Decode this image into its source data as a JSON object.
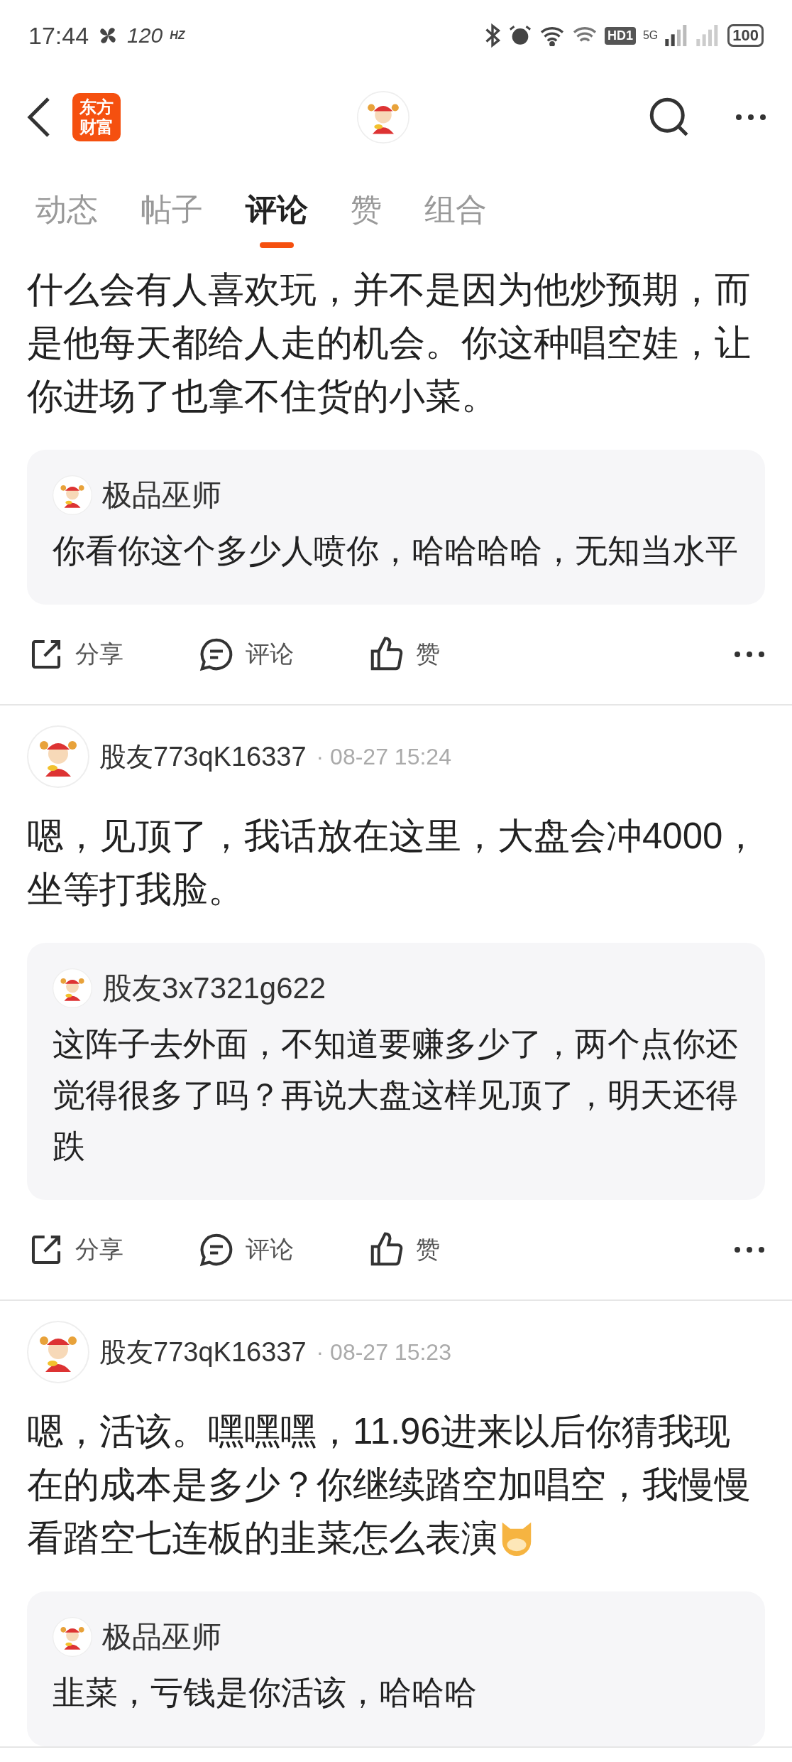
{
  "status_bar": {
    "time": "17:44",
    "refresh_rate": "120",
    "refresh_unit": "HZ",
    "hd_label": "HD1",
    "network": "5G",
    "battery": "100"
  },
  "header": {
    "logo_lines": [
      "东方",
      "财富"
    ]
  },
  "tabs": [
    {
      "label": "动态",
      "selected": false
    },
    {
      "label": "帖子",
      "selected": false
    },
    {
      "label": "评论",
      "selected": true
    },
    {
      "label": "赞",
      "selected": false
    },
    {
      "label": "组合",
      "selected": false
    }
  ],
  "comments": [
    {
      "text": "什么会有人喜欢玩，并不是因为他炒预期，而是他每天都给人走的机会。你这种唱空娃，让你进场了也拿不住货的小菜。",
      "trailing_emoji": false,
      "reply": {
        "author": "极品巫师",
        "text": "你看你这个多少人喷你，哈哈哈哈，无知当水平"
      },
      "actions": [
        {
          "kind": "share",
          "label": "分享"
        },
        {
          "kind": "comment",
          "label": "评论"
        },
        {
          "kind": "like",
          "label": "赞"
        }
      ]
    },
    {
      "author": "股友773qK16337",
      "time": "· 08-27 15:24",
      "text": "嗯，见顶了，我话放在这里，大盘会冲4000，坐等打我脸。",
      "trailing_emoji": false,
      "reply": {
        "author": "股友3x7321g622",
        "text": "这阵子去外面，不知道要赚多少了，两个点你还觉得很多了吗？再说大盘这样见顶了，明天还得跌"
      },
      "actions": [
        {
          "kind": "share",
          "label": "分享"
        },
        {
          "kind": "comment",
          "label": "评论"
        },
        {
          "kind": "like",
          "label": "赞"
        }
      ]
    },
    {
      "author": "股友773qK16337",
      "time": "· 08-27 15:23",
      "text": "嗯，活该。嘿嘿嘿，11.96进来以后你猜我现在的成本是多少？你继续踏空加唱空，我慢慢看踏空七连板的韭菜怎么表演",
      "trailing_emoji": true,
      "reply": {
        "author": "极品巫师",
        "text": "韭菜，亏钱是你活该，哈哈哈"
      }
    }
  ]
}
